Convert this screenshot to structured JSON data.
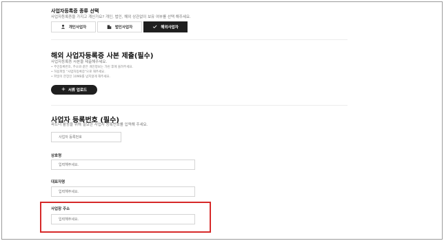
{
  "type_section": {
    "title": "사업자등록증 종류 선택",
    "subtitle": "사업자등록증을 가지고 계신가요? 개인, 법인, 해외 상관없이 보유 여부를 선택 해주세요.",
    "options": [
      {
        "label": "개인사업자",
        "icon": "person-icon",
        "selected": false
      },
      {
        "label": "법인사업자",
        "icon": "building-icon",
        "selected": false
      },
      {
        "label": "해외사업자",
        "icon": "check-icon",
        "selected": true
      }
    ]
  },
  "copy_section": {
    "title": "해외 사업자등록증 사본 제출(필수)",
    "subtitle": "사업자등록증 사본을 제출해주세요.",
    "notes": [
      "• 주민등록번호, 주소와 같은 개인정보는 가린 후에 올려주세요.",
      "• 허용파일 \"사업자등록증\"으로 해주세요.",
      "• 파일이 한장인 10MB를 넘지않게 해주세요."
    ],
    "upload_label": "서류 업로드",
    "upload_icon": "plus-icon"
  },
  "number_section": {
    "title": "사업자 등록번호 (필수)",
    "subtitle": "파트너 활동을 위해 필요한 사업자 등록번호를 입력해 주세요.",
    "number_placeholder": "사업자 등록번호"
  },
  "fields": {
    "company": {
      "label": "상호명",
      "placeholder": "입력해주세요."
    },
    "ceo": {
      "label": "대표자명",
      "placeholder": "입력해주세요."
    },
    "address": {
      "label": "사업장 주소",
      "placeholder": "입력해주세요."
    }
  },
  "colors": {
    "highlight": "#d62828",
    "button_dark": "#1f1f1f"
  }
}
